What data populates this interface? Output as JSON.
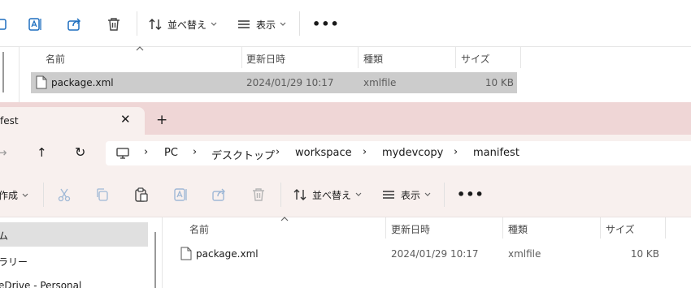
{
  "back_window": {
    "toolbar": {
      "sort_label": "並べ替え",
      "view_label": "表示",
      "more_label": "•••"
    },
    "columns": {
      "name": "名前",
      "modified": "更新日時",
      "type": "種類",
      "size": "サイズ"
    },
    "rows": [
      {
        "name": "package.xml",
        "modified": "2024/01/29 10:17",
        "type": "xmlfile",
        "size": "10 KB"
      }
    ]
  },
  "front_window": {
    "tab": {
      "title": "fest",
      "close": "✕",
      "add": "+"
    },
    "nav": {
      "forward": "→",
      "up": "↑",
      "refresh": "↻"
    },
    "breadcrumb": {
      "separator": "›",
      "items": [
        "PC",
        "デスクトップ",
        "workspace",
        "mydevcopy",
        "manifest"
      ]
    },
    "toolbar": {
      "new_label": "作成",
      "sort_label": "並べ替え",
      "view_label": "表示",
      "more_label": "•••"
    },
    "sidebar": {
      "items": [
        {
          "label": "ム"
        },
        {
          "label": "ラリー"
        },
        {
          "label": "eDrive - Personal"
        }
      ]
    },
    "columns": {
      "name": "名前",
      "modified": "更新日時",
      "type": "種類",
      "size": "サイズ"
    },
    "rows": [
      {
        "name": "package.xml",
        "modified": "2024/01/29 10:17",
        "type": "xmlfile",
        "size": "10 KB"
      }
    ]
  },
  "colors": {
    "tab_strip": "#efd6d6",
    "active_surface": "#f8f0ee",
    "selected_row": "#cccccc",
    "accent_icon": "#1f6fbf"
  }
}
